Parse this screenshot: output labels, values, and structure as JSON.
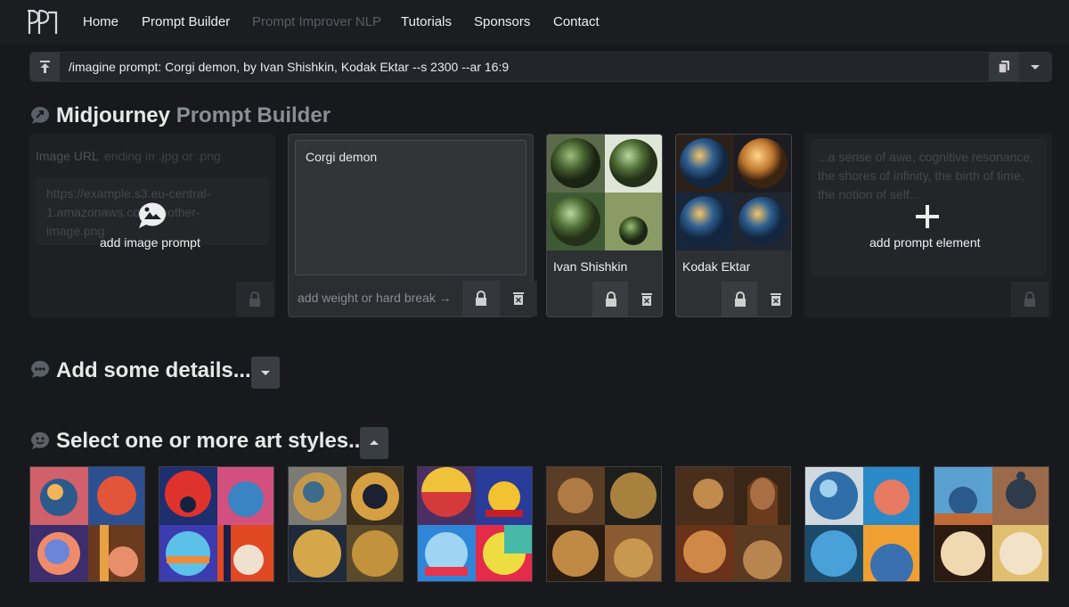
{
  "nav": {
    "links": [
      "Home",
      "Prompt Builder",
      "Prompt Improver NLP",
      "Tutorials",
      "Sponsors",
      "Contact"
    ]
  },
  "prompt_bar": {
    "text": "/imagine prompt: Corgi demon, by Ivan Shishkin, Kodak Ektar --s 2300 --ar 16:9"
  },
  "builder": {
    "title": "Midjourney",
    "title_muted": "Prompt Builder",
    "image_card": {
      "label": "Image URL",
      "hint": "ending in .jpg or .png",
      "placeholder": "https://example.s3.eu-central-1.amazonaws.com/another-image.png",
      "overlay_label": "add image prompt"
    },
    "text_card": {
      "value": "Corgi demon",
      "weight_hint": "add weight or hard break →"
    },
    "artist_cards": [
      {
        "label": "Ivan Shishkin"
      },
      {
        "label": "Kodak Ektar"
      }
    ],
    "add_card": {
      "placeholder": "...a sense of awe, cognitive resonance, the shores of infinity, the birth of time, the notion of self...",
      "label": "add prompt element"
    }
  },
  "details": {
    "title": "Add some details..."
  },
  "styles": {
    "title": "Select one or more art styles..."
  },
  "colors": {
    "accent": "#3a3d42",
    "background": "#17191c"
  }
}
